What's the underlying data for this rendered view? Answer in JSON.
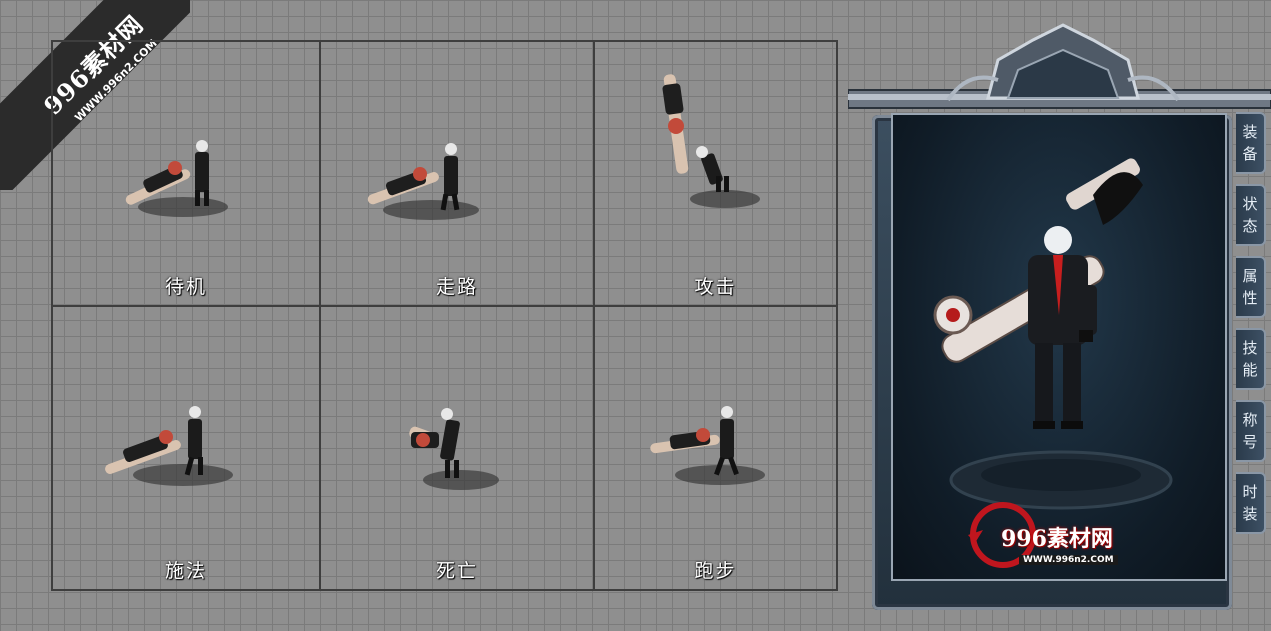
{
  "watermark": {
    "title": "996素材网",
    "url": "WWW.996n2.COM"
  },
  "animations": [
    {
      "label": "待机"
    },
    {
      "label": "走路"
    },
    {
      "label": "攻击"
    },
    {
      "label": "施法"
    },
    {
      "label": "死亡"
    },
    {
      "label": "跑步"
    }
  ],
  "character_panel": {
    "tabs": [
      {
        "label": "装备"
      },
      {
        "label": "状态"
      },
      {
        "label": "属性"
      },
      {
        "label": "技能"
      },
      {
        "label": "称号"
      },
      {
        "label": "时装"
      }
    ],
    "logo_text": "996素材网",
    "logo_url": "WWW.996n2.COM"
  },
  "colors": {
    "grid_bg": "#8f8f8f",
    "frame_accent": "#c0161e"
  }
}
